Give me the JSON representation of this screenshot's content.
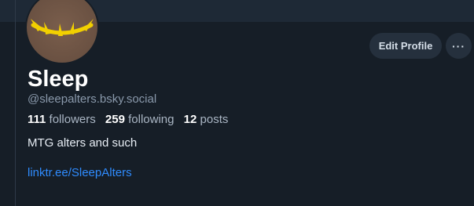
{
  "profile": {
    "display_name": "Sleep",
    "handle": "@sleepalters.bsky.social",
    "bio": "MTG alters and such",
    "link": "linktr.ee/SleepAlters"
  },
  "stats": {
    "followers_count": "111",
    "followers_label": "followers",
    "following_count": "259",
    "following_label": "following",
    "posts_count": "12",
    "posts_label": "posts"
  },
  "actions": {
    "edit_label": "Edit Profile",
    "more_label": "···"
  },
  "colors": {
    "background": "#161e27",
    "banner": "#1e2936",
    "link": "#2f8cff",
    "button_bg": "#25303d"
  },
  "icons": {
    "avatar": "closed-eye-lashes",
    "more": "ellipsis-icon"
  }
}
